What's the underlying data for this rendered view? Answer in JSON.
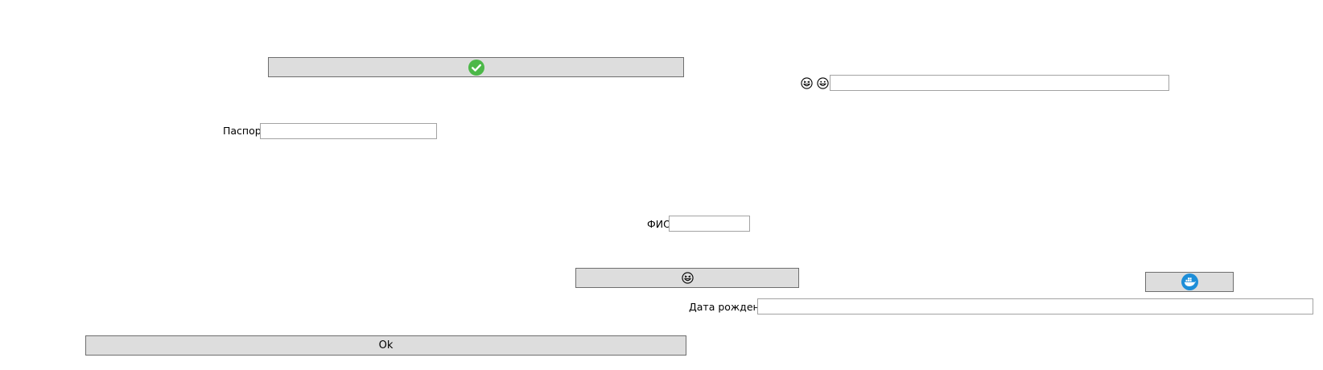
{
  "window": {
    "background": "#ffffff"
  },
  "buttons": {
    "confirm": {
      "icon": "check-circle-icon",
      "accent": "#4cb848"
    },
    "laugh": {
      "icon": "grinning-squint-icon"
    },
    "docker": {
      "icon": "docker-whale-icon",
      "accent": "#1d8ed8"
    },
    "ok": {
      "label": "Ok"
    }
  },
  "emoji_field": {
    "icons": [
      "grinning-squint-icon",
      "grinning-face-icon"
    ],
    "value": ""
  },
  "passport": {
    "label": "Паспорт",
    "value": ""
  },
  "fio": {
    "label": "ФИО",
    "value": ""
  },
  "birth_date": {
    "label": "Дата рождения",
    "value": ""
  }
}
